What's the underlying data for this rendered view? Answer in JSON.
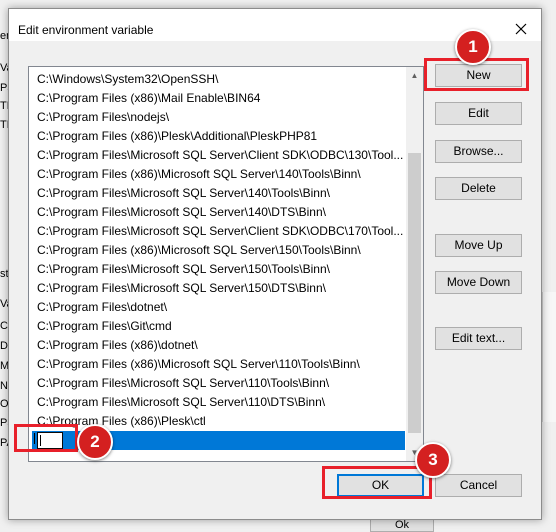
{
  "background": {
    "left_fragments": [
      "er",
      "Va",
      "Pa",
      "TE",
      "TN",
      "ste",
      "Va",
      "Co",
      "Dr",
      "Mi",
      "NU",
      "OS",
      "Pa",
      "PA"
    ],
    "bottom_button": "Ok"
  },
  "dialog": {
    "title": "Edit environment variable",
    "close_glyph": "✕"
  },
  "paths": [
    "C:\\Windows\\System32\\OpenSSH\\",
    "C:\\Program Files (x86)\\Mail Enable\\BIN64",
    "C:\\Program Files\\nodejs\\",
    "C:\\Program Files (x86)\\Plesk\\Additional\\PleskPHP81",
    "C:\\Program Files\\Microsoft SQL Server\\Client SDK\\ODBC\\130\\Tool...",
    "C:\\Program Files (x86)\\Microsoft SQL Server\\140\\Tools\\Binn\\",
    "C:\\Program Files\\Microsoft SQL Server\\140\\Tools\\Binn\\",
    "C:\\Program Files\\Microsoft SQL Server\\140\\DTS\\Binn\\",
    "C:\\Program Files\\Microsoft SQL Server\\Client SDK\\ODBC\\170\\Tool...",
    "C:\\Program Files (x86)\\Microsoft SQL Server\\150\\Tools\\Binn\\",
    "C:\\Program Files\\Microsoft SQL Server\\150\\Tools\\Binn\\",
    "C:\\Program Files\\Microsoft SQL Server\\150\\DTS\\Binn\\",
    "C:\\Program Files\\dotnet\\",
    "C:\\Program Files\\Git\\cmd",
    "C:\\Program Files (x86)\\dotnet\\",
    "C:\\Program Files (x86)\\Microsoft SQL Server\\110\\Tools\\Binn\\",
    "C:\\Program Files\\Microsoft SQL Server\\110\\Tools\\Binn\\",
    "C:\\Program Files\\Microsoft SQL Server\\110\\DTS\\Binn\\",
    "C:\\Program Files (x86)\\Plesk\\ctl"
  ],
  "new_entry": {
    "value": ""
  },
  "buttons": {
    "new": "New",
    "edit": "Edit",
    "browse": "Browse...",
    "delete": "Delete",
    "move_up": "Move Up",
    "move_down": "Move Down",
    "edit_text": "Edit text...",
    "ok": "OK",
    "cancel": "Cancel"
  },
  "markers": {
    "one": "1",
    "two": "2",
    "three": "3"
  },
  "colors": {
    "selection": "#0078d7",
    "highlight": "#e8202a",
    "marker": "#d42020"
  }
}
